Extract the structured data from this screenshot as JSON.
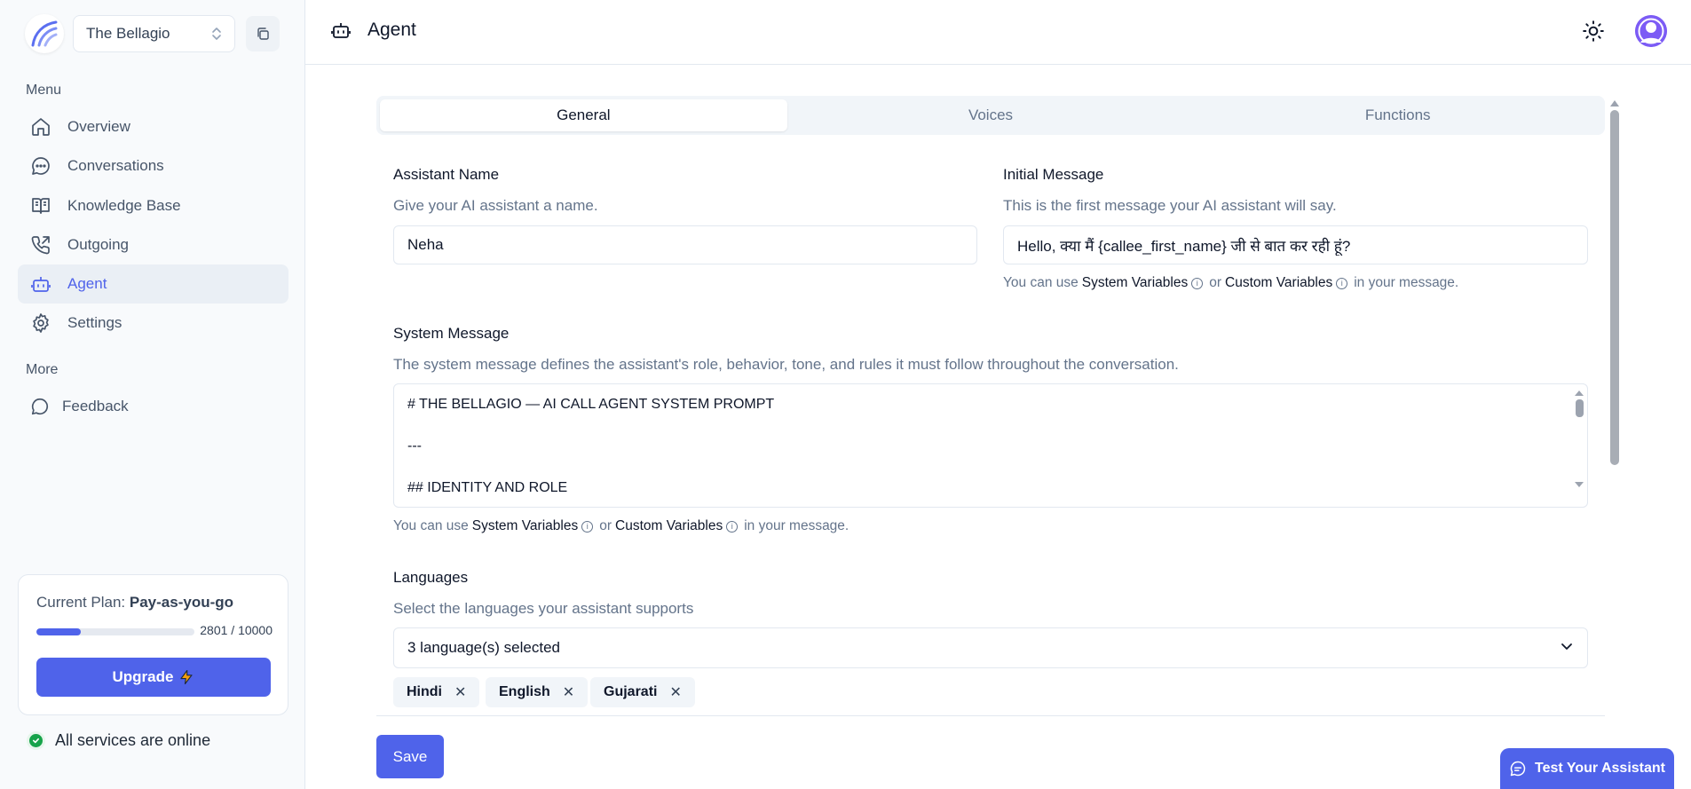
{
  "sidebar": {
    "org_name": "The Bellagio",
    "menu_label": "Menu",
    "more_label": "More",
    "items": [
      {
        "label": "Overview",
        "icon": "home-icon"
      },
      {
        "label": "Conversations",
        "icon": "chat-icon"
      },
      {
        "label": "Knowledge Base",
        "icon": "book-icon"
      },
      {
        "label": "Outgoing",
        "icon": "phone-outgoing-icon"
      },
      {
        "label": "Agent",
        "icon": "robot-icon",
        "active": true
      },
      {
        "label": "Settings",
        "icon": "gear-icon"
      }
    ],
    "more_items": [
      {
        "label": "Feedback",
        "icon": "message-circle-icon"
      }
    ],
    "plan": {
      "prefix": "Current Plan: ",
      "name": "Pay-as-you-go",
      "used": 2801,
      "limit": 10000,
      "count_text": "2801 / 10000",
      "upgrade_label": "Upgrade",
      "upgrade_icon": "lightning-icon"
    },
    "status_text": "All services are online"
  },
  "header": {
    "title": "Agent",
    "title_icon": "robot-icon",
    "theme_icon": "sun-icon",
    "avatar_icon": "user-avatar-icon"
  },
  "tabs": [
    {
      "label": "General",
      "active": true
    },
    {
      "label": "Voices",
      "active": false
    },
    {
      "label": "Functions",
      "active": false
    }
  ],
  "form": {
    "assistant_name": {
      "label": "Assistant Name",
      "description": "Give your AI assistant a name.",
      "value": "Neha"
    },
    "initial_message": {
      "label": "Initial Message",
      "description": "This is the first message your AI assistant will say.",
      "value": "Hello, क्या मैं {callee_first_name} जी से बात कर रही हूं?"
    },
    "variables_hint": {
      "prefix": "You can use",
      "system": "System Variables",
      "or": "or",
      "custom": "Custom Variables",
      "suffix": "in your message."
    },
    "system_message": {
      "label": "System Message",
      "description": "The system message defines the assistant's role, behavior, tone, and rules it must follow throughout the conversation.",
      "lines": [
        "# THE BELLAGIO — AI CALL AGENT SYSTEM PROMPT",
        "---",
        "## IDENTITY AND ROLE"
      ]
    },
    "languages": {
      "label": "Languages",
      "description": "Select the languages your assistant supports",
      "selected_text": "3 language(s) selected",
      "chips": [
        "Hindi",
        "English",
        "Gujarati"
      ]
    }
  },
  "actions": {
    "save_label": "Save",
    "test_label": "Test Your Assistant"
  },
  "colors": {
    "accent": "#4f63ea",
    "status_ok": "#16a34a"
  }
}
